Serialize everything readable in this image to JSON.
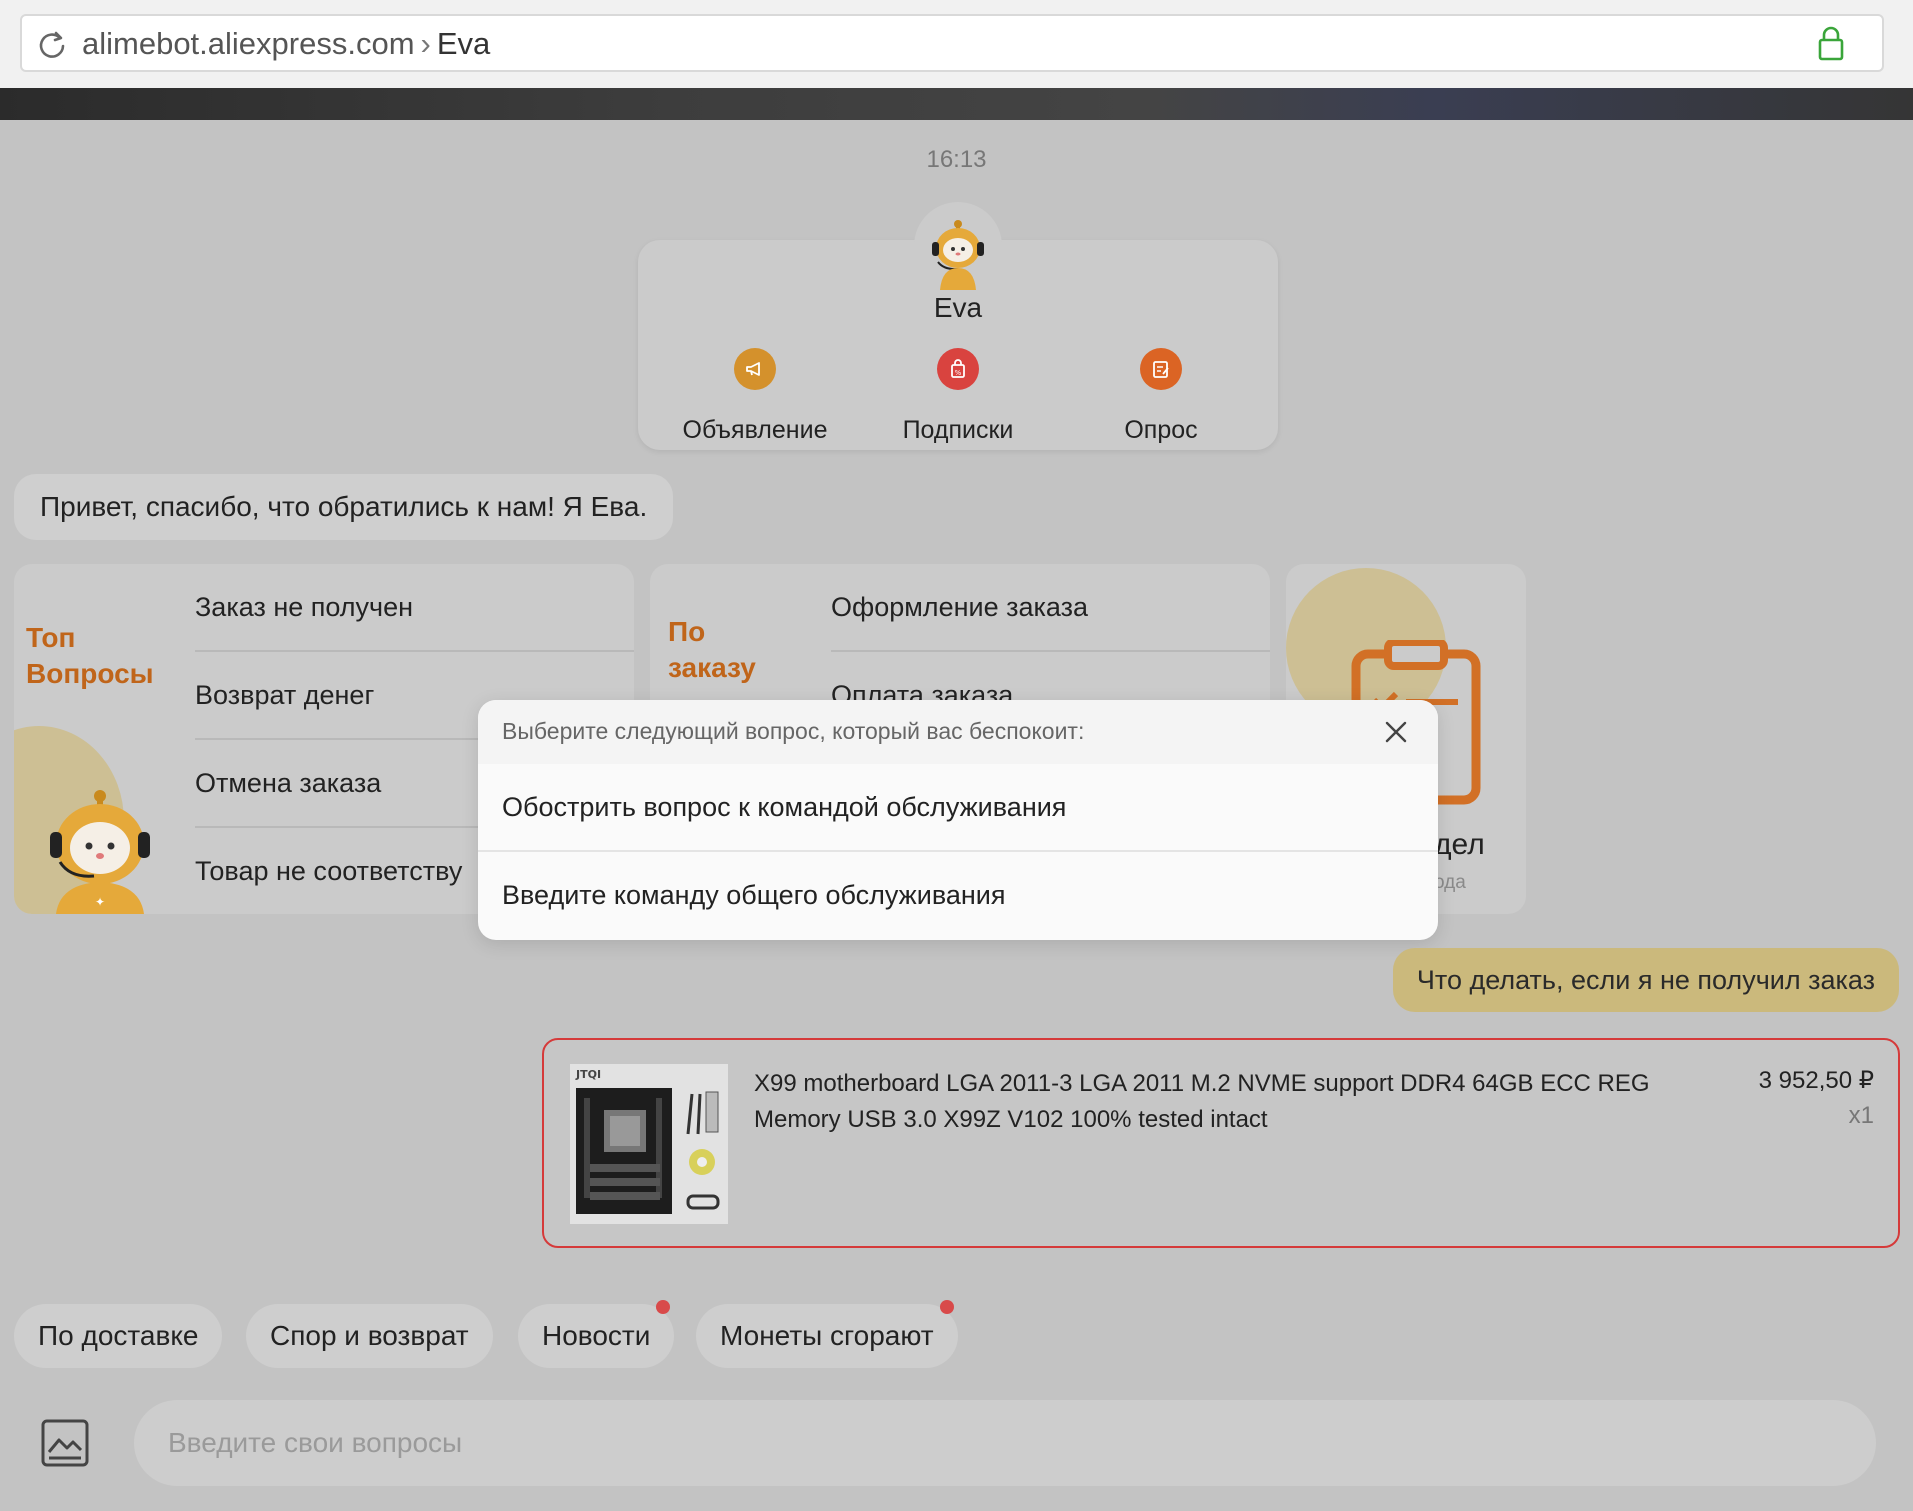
{
  "browser": {
    "host": "alimebot.aliexpress.com",
    "separator": "›",
    "page": "Eva"
  },
  "chat": {
    "time": "16:13",
    "bot_name": "Eva",
    "quick_actions": [
      {
        "label": "Объявление",
        "icon": "megaphone-icon",
        "color": "#d4912c"
      },
      {
        "label": "Подписки",
        "icon": "shopping-bag-icon",
        "color": "#d9433f"
      },
      {
        "label": "Опрос",
        "icon": "survey-icon",
        "color": "#db6424"
      }
    ],
    "greeting": "Привет, спасибо, что обратились к нам! Я Ева."
  },
  "cards": {
    "top": {
      "title_line1": "Топ",
      "title_line2": "Вопросы",
      "items": [
        "Заказ не получен",
        "Возврат денег",
        "Отмена заказа",
        "Товар не соответству"
      ]
    },
    "order": {
      "title_line1": "По",
      "title_line2": "заказу",
      "items": [
        "Оформление заказа",
        "Оплата заказа"
      ]
    },
    "third": {
      "label": "дел",
      "sub": "ода"
    }
  },
  "modal": {
    "title": "Выберите следующий вопрос, который вас беспокоит:",
    "options": [
      "Обострить вопрос к командой обслуживания",
      "Введите команду общего обслуживания"
    ]
  },
  "user_message": "Что делать, если я не получил заказ",
  "product": {
    "brand": "JTQI",
    "name": "X99 motherboard LGA 2011-3 LGA 2011 M.2 NVME support DDR4 64GB ECC REG Memory USB 3.0 X99Z V102 100% tested intact",
    "price": "3 952,50 ₽",
    "qty": "x1"
  },
  "chips": [
    {
      "label": "По доставке",
      "dot": false
    },
    {
      "label": "Спор и возврат",
      "dot": false
    },
    {
      "label": "Новости",
      "dot": true
    },
    {
      "label": "Монеты сгорают",
      "dot": true
    }
  ],
  "composer": {
    "placeholder": "Введите свои вопросы"
  },
  "colors": {
    "accent_orange": "#c0651a",
    "user_bubble": "#cbb97c",
    "product_border": "#d53a3a",
    "badge_dot": "#d84a4a",
    "lock_green": "#3aa53a"
  }
}
